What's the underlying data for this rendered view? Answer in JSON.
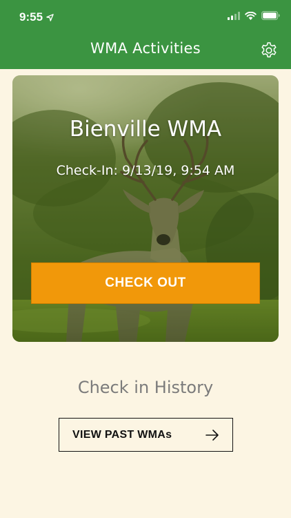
{
  "status_bar": {
    "time": "9:55",
    "location_icon": "location-arrow-icon",
    "signal_icon": "cellular-signal-icon",
    "wifi_icon": "wifi-icon",
    "battery_icon": "battery-icon"
  },
  "nav": {
    "title": "WMA Activities",
    "settings_icon": "gear-icon"
  },
  "card": {
    "title": "Bienville WMA",
    "checkin": "Check-In: 9/13/19, 9:54 AM",
    "checkout_label": "CHECK OUT"
  },
  "history": {
    "label": "Check in History",
    "past_button_label": "VIEW PAST WMAs",
    "arrow_icon": "arrow-right-icon"
  },
  "colors": {
    "header_green": "#3b9441",
    "background_cream": "#fcf5e3",
    "checkout_orange": "#f1980a"
  }
}
